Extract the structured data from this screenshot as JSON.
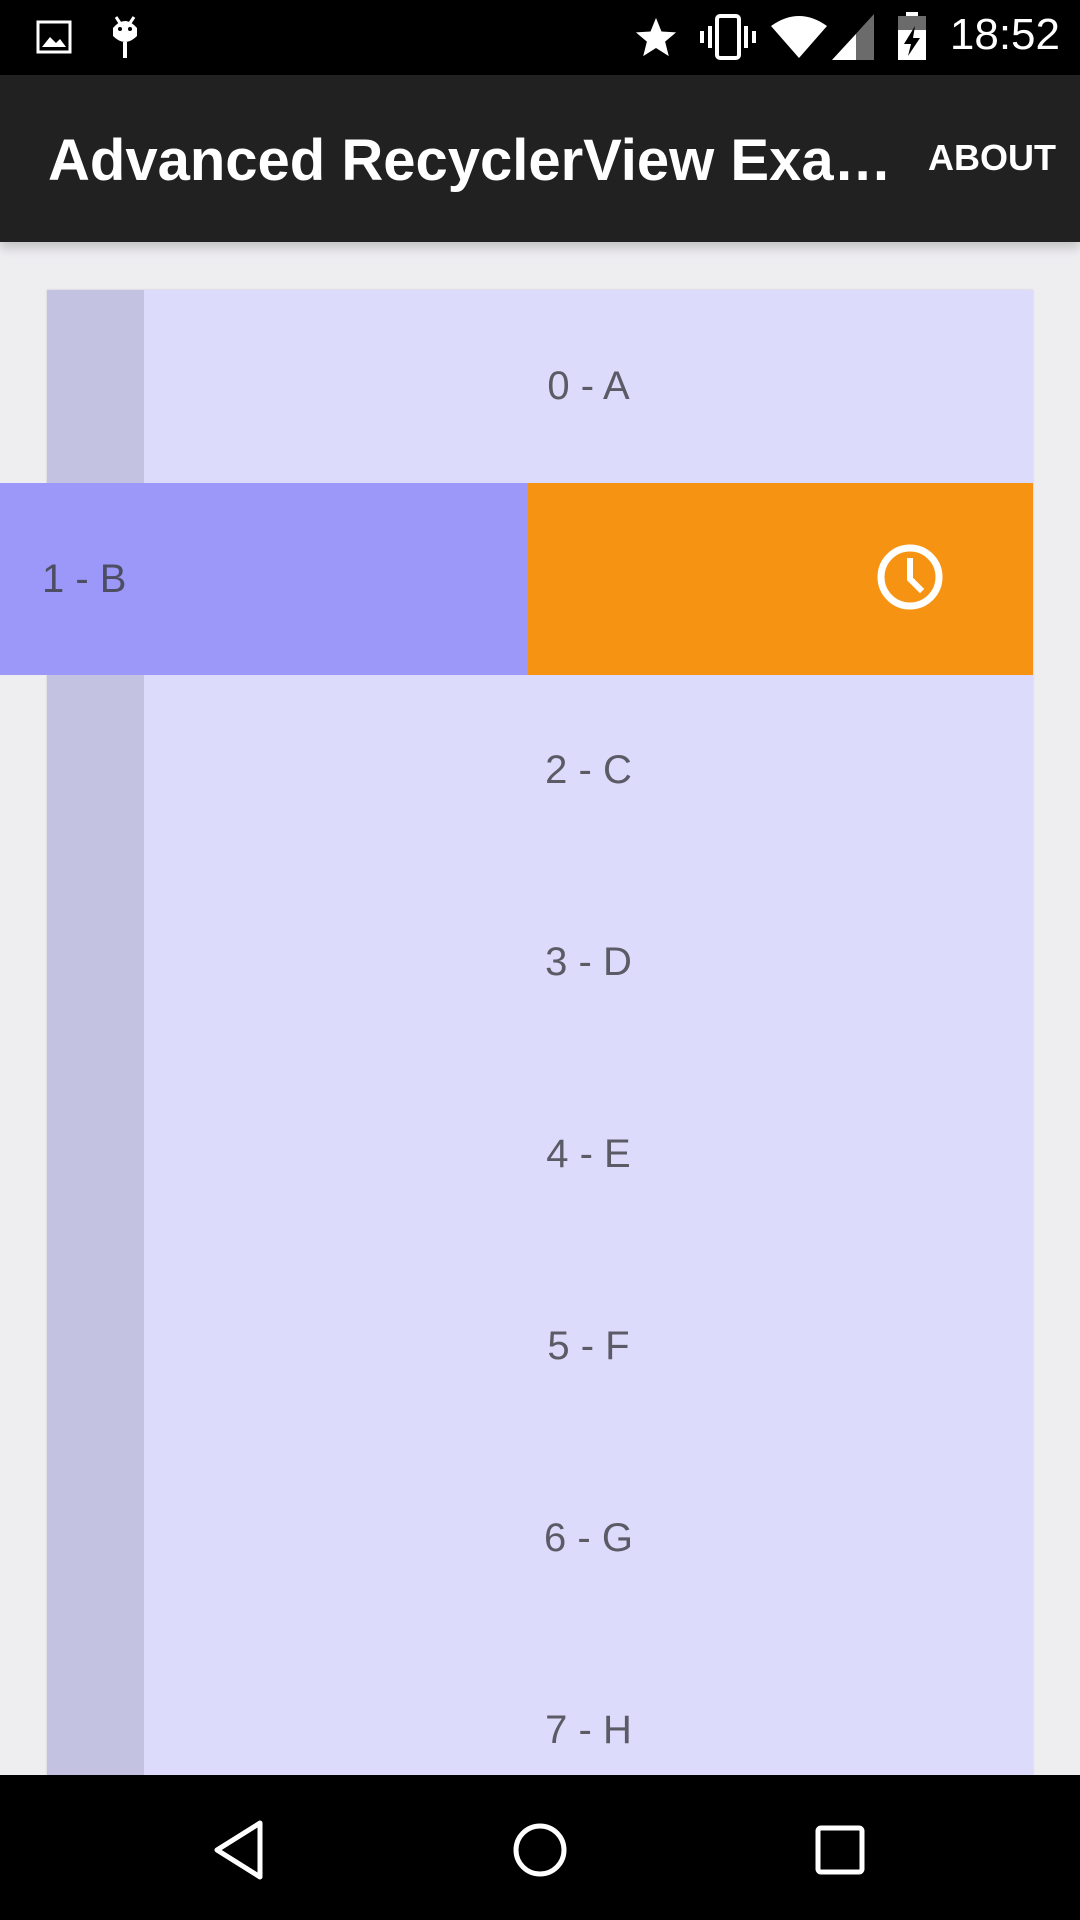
{
  "status_bar": {
    "time": "18:52",
    "icons": [
      "image-icon",
      "android-debug-icon",
      "star-icon",
      "vibrate-icon",
      "wifi-icon",
      "signal-icon",
      "battery-charging-icon"
    ]
  },
  "app_bar": {
    "title": "Advanced RecyclerView Exa…",
    "action": "ABOUT"
  },
  "list": {
    "items": [
      {
        "label": "0 - A"
      },
      {
        "label": "1 - B",
        "swiped": true,
        "swipe_action_icon": "clock-icon"
      },
      {
        "label": "2 - C"
      },
      {
        "label": "3 - D"
      },
      {
        "label": "4 - E"
      },
      {
        "label": "5 - F"
      },
      {
        "label": "6 - G"
      },
      {
        "label": "7 - H"
      }
    ]
  },
  "colors": {
    "app_bar": "#212121",
    "item_bg": "#dddbfc",
    "handle": "#c3c2e0",
    "swiped_item": "#9b98fa",
    "swipe_action_bg": "#f79312"
  },
  "nav_bar": {
    "buttons": [
      "back-icon",
      "home-icon",
      "recents-icon"
    ]
  }
}
